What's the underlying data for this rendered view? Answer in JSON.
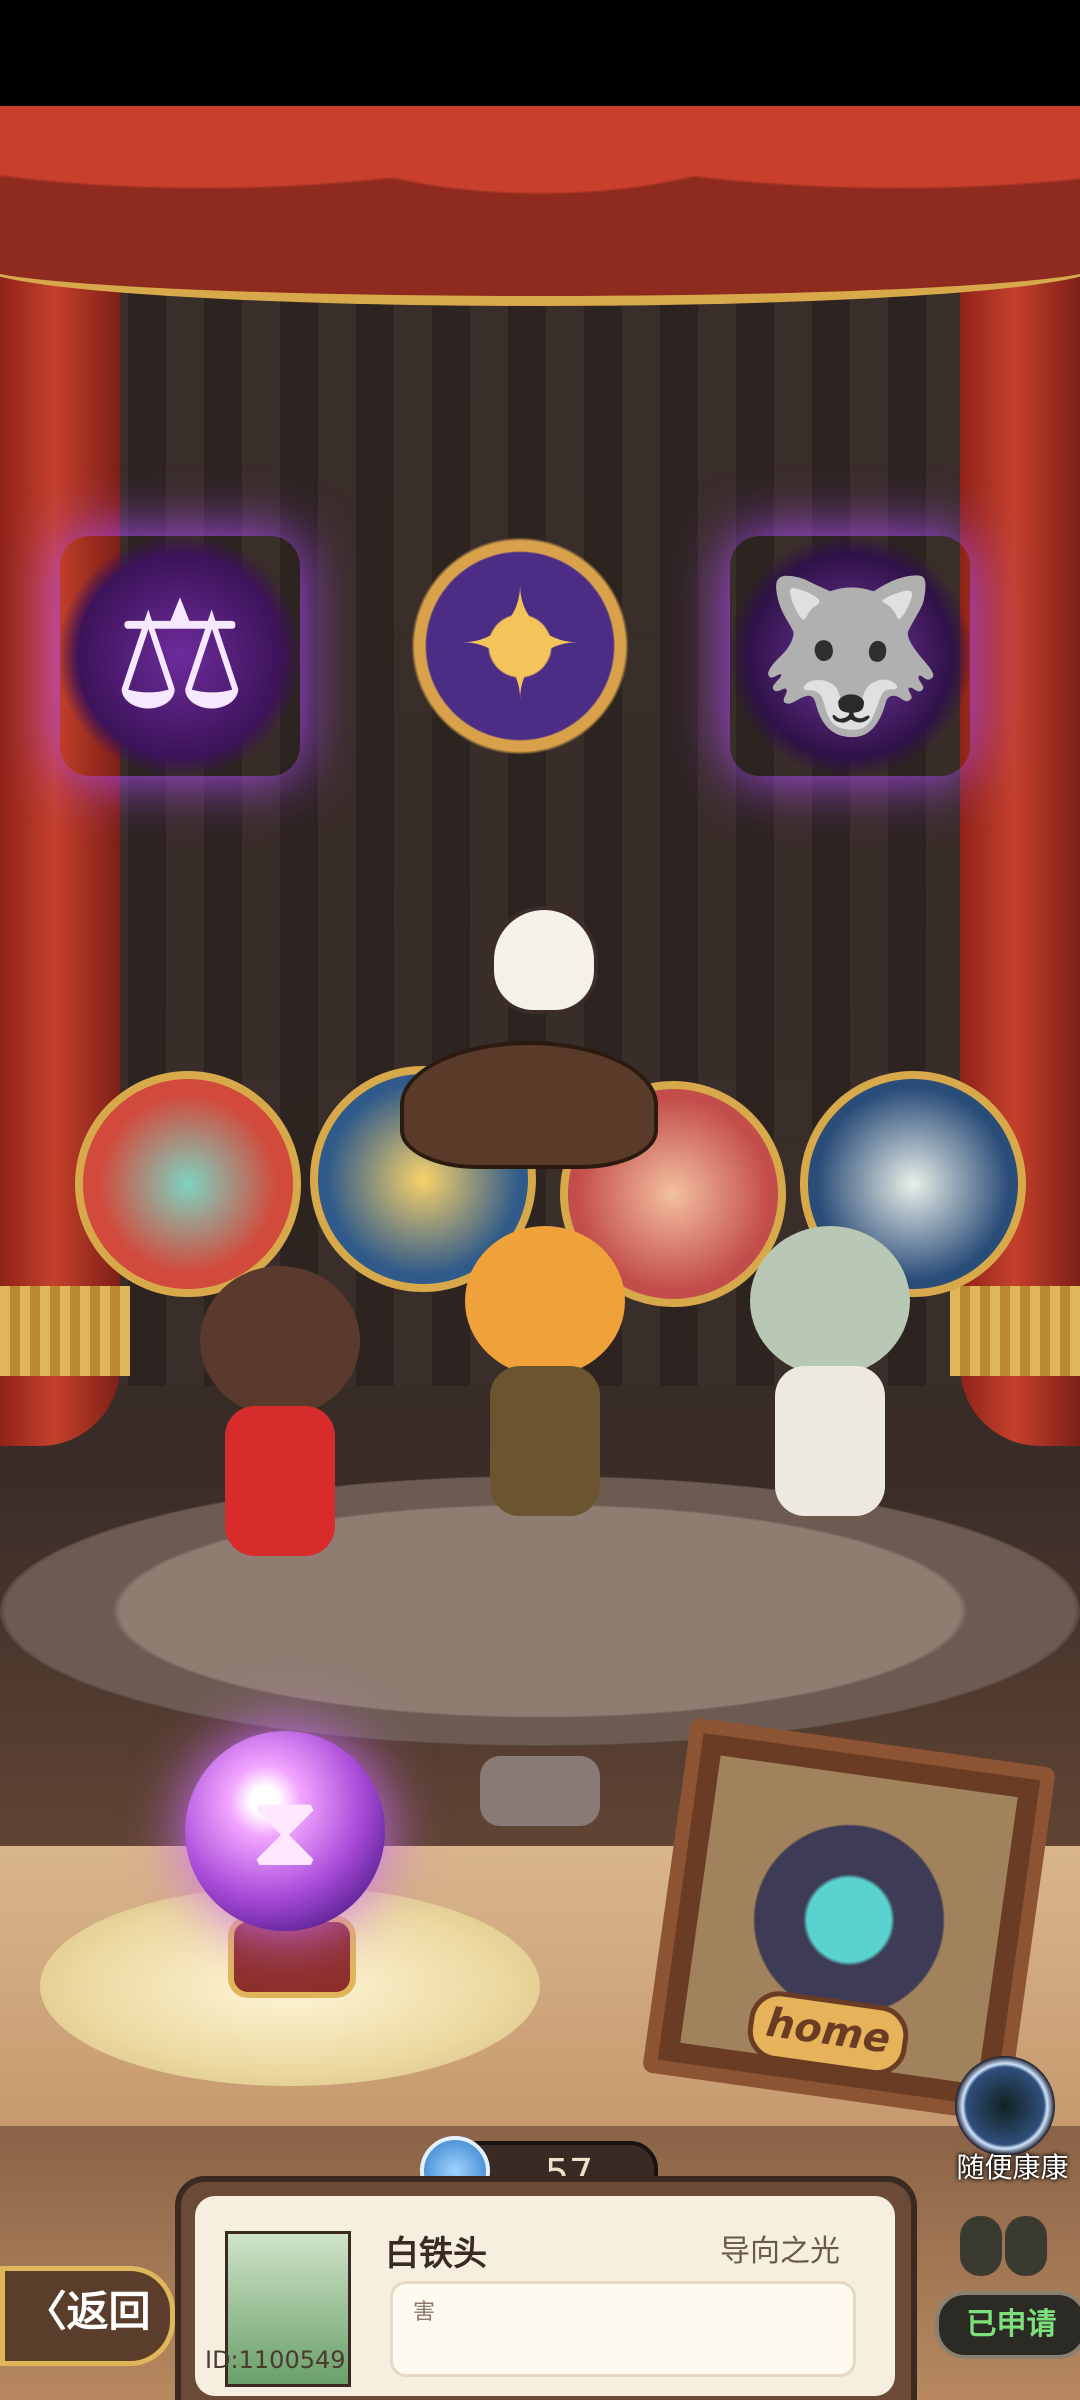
{
  "stage": {
    "emblems": [
      {
        "name": "lantern-scale-emblem",
        "glyph": "⚖"
      },
      {
        "name": "compass-star-emblem",
        "glyph": "✦"
      },
      {
        "name": "wolf-emblem",
        "glyph": "🐺"
      }
    ],
    "orb_glyph": "⧗",
    "home_frame_label": "home"
  },
  "counter": {
    "value": "57",
    "icon": "water-drop-icon"
  },
  "profile": {
    "name": "白铁头",
    "tag": "导向之光",
    "id": "ID:1100549",
    "message": "害"
  },
  "buttons": {
    "back_label": "〈返回",
    "random_label": "随便康康",
    "applied_label": "已申请"
  },
  "colors": {
    "curtain": "#c5412c",
    "gold_trim": "#e0b65a",
    "orb_glow": "#d070ff",
    "applied_text": "#7ee07a"
  }
}
